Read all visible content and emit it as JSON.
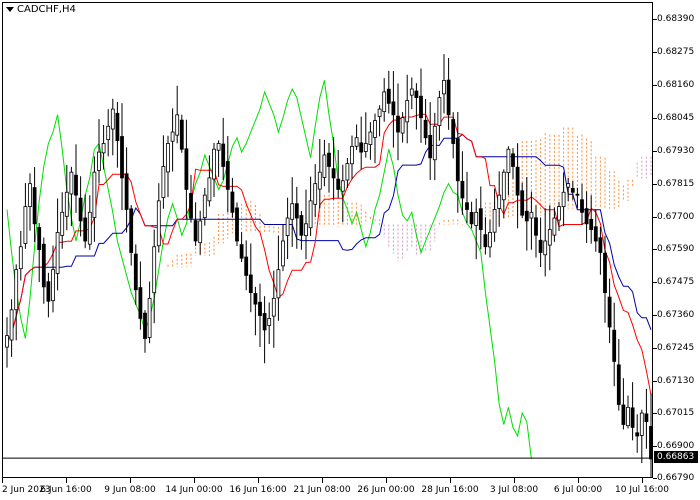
{
  "chart_title": "CADCHF,H4",
  "current_price": "0.66863",
  "colors": {
    "candle": "#000000",
    "tenkan": "#ff0000",
    "kijun": "#0000aa",
    "chikou": "#00dd00",
    "cloud_bull": "#ff8c3a",
    "cloud_bear": "#d896c8",
    "price_line": "#000000"
  },
  "icons": {
    "menu": "triangle-down-icon"
  },
  "chart_data": {
    "type": "candlestick",
    "instrument": "CADCHF",
    "timeframe": "H4",
    "ylim": [
      0.6679,
      0.6845
    ],
    "y_ticks": [
      "0.68390",
      "0.68275",
      "0.68160",
      "0.68045",
      "0.67930",
      "0.67815",
      "0.67700",
      "0.67590",
      "0.67475",
      "0.67360",
      "0.67245",
      "0.67130",
      "0.67015",
      "0.66900",
      "0.66790"
    ],
    "x_ticks": [
      "2 Jun 2023",
      "6 Jun 16:00",
      "9 Jun 08:00",
      "14 Jun 00:00",
      "16 Jun 16:00",
      "21 Jun 08:00",
      "26 Jun 00:00",
      "28 Jun 16:00",
      "3 Jul 08:00",
      "6 Jul 00:00",
      "10 Jul 16:00"
    ],
    "last_price": 0.66863,
    "indicators": [
      "Ichimoku Kinko Hyo (Tenkan-sen, Kijun-sen, Chikou Span, Kumo)"
    ],
    "closes": [
      0.6729,
      0.6738,
      0.6752,
      0.676,
      0.6774,
      0.6782,
      0.6768,
      0.6759,
      0.6746,
      0.6741,
      0.6752,
      0.6765,
      0.6772,
      0.6779,
      0.6786,
      0.6778,
      0.6769,
      0.6762,
      0.6772,
      0.6786,
      0.6793,
      0.6796,
      0.6802,
      0.6808,
      0.6797,
      0.6784,
      0.6773,
      0.6758,
      0.6745,
      0.6735,
      0.6728,
      0.6742,
      0.676,
      0.6776,
      0.6788,
      0.6796,
      0.68,
      0.6806,
      0.6794,
      0.678,
      0.677,
      0.6762,
      0.6769,
      0.6778,
      0.6784,
      0.6794,
      0.6796,
      0.6788,
      0.678,
      0.6772,
      0.6762,
      0.6756,
      0.675,
      0.6744,
      0.674,
      0.6736,
      0.6731,
      0.6735,
      0.6742,
      0.6752,
      0.6762,
      0.677,
      0.6775,
      0.677,
      0.6764,
      0.6768,
      0.6776,
      0.6782,
      0.6786,
      0.6792,
      0.6788,
      0.6784,
      0.678,
      0.6783,
      0.6789,
      0.6795,
      0.6798,
      0.6793,
      0.6796,
      0.68,
      0.6804,
      0.6808,
      0.6814,
      0.681,
      0.6806,
      0.68,
      0.6805,
      0.6811,
      0.6815,
      0.6812,
      0.6805,
      0.6798,
      0.6791,
      0.6802,
      0.6812,
      0.6818,
      0.6806,
      0.6796,
      0.6783,
      0.6777,
      0.6773,
      0.6768,
      0.6772,
      0.6766,
      0.676,
      0.6765,
      0.6773,
      0.6778,
      0.6786,
      0.6794,
      0.6788,
      0.6778,
      0.6771,
      0.6769,
      0.6772,
      0.6764,
      0.6758,
      0.6762,
      0.6766,
      0.677,
      0.6774,
      0.6779,
      0.6782,
      0.6779,
      0.6778,
      0.6772,
      0.6768,
      0.6766,
      0.6762,
      0.6758,
      0.6744,
      0.6732,
      0.672,
      0.6705,
      0.6698,
      0.6704,
      0.6697,
      0.6694,
      0.6702,
      0.6699,
      0.6686
    ]
  }
}
